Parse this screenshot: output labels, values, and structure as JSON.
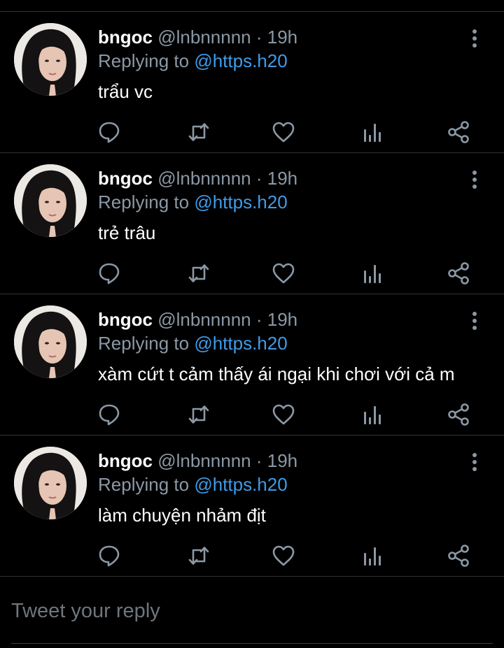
{
  "tweets": [
    {
      "name": "bngoc",
      "handle": "@lnbnnnnn",
      "separator": "·",
      "time": "19h",
      "replying_prefix": "Replying to ",
      "replying_to": "@https.h20",
      "text": "trẩu vc"
    },
    {
      "name": "bngoc",
      "handle": "@lnbnnnnn",
      "separator": "·",
      "time": "19h",
      "replying_prefix": "Replying to ",
      "replying_to": "@https.h20",
      "text": "trẻ trâu"
    },
    {
      "name": "bngoc",
      "handle": "@lnbnnnnn",
      "separator": "·",
      "time": "19h",
      "replying_prefix": "Replying to ",
      "replying_to": "@https.h20",
      "text": "xàm cứt t cảm thấy ái ngại khi chơi với cả m"
    },
    {
      "name": "bngoc",
      "handle": "@lnbnnnnn",
      "separator": "·",
      "time": "19h",
      "replying_prefix": "Replying to ",
      "replying_to": "@https.h20",
      "text": "làm chuyện nhảm địt"
    }
  ],
  "reply_box": {
    "placeholder": "Tweet your reply"
  },
  "icons": {
    "more": "more-vertical-icon",
    "reply": "reply-icon",
    "retweet": "retweet-icon",
    "like": "heart-icon",
    "views": "analytics-icon",
    "share": "share-icon"
  },
  "colors": {
    "background": "#000000",
    "text": "#ffffff",
    "secondary": "#8b98a5",
    "mention": "#3f9be8",
    "divider": "#2f3336"
  }
}
